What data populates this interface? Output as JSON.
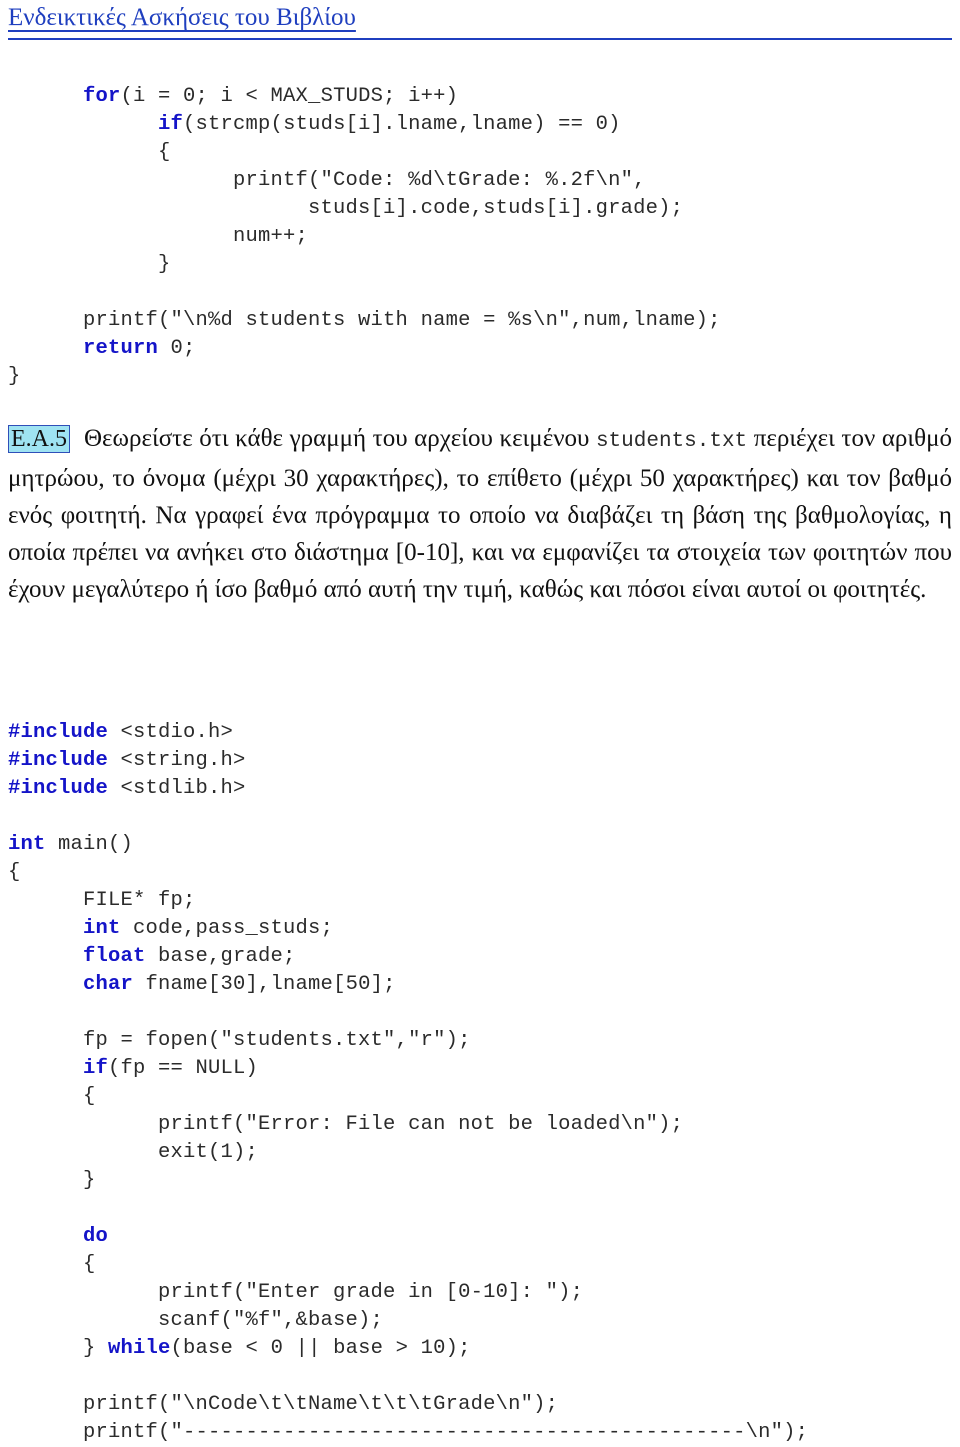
{
  "header": {
    "title": "Ενδεικτικές Ασκήσεις του Βιβλίου",
    "accent_color": "#1f3fbf"
  },
  "code_block_top": {
    "language": "c",
    "keyword_color": "#1414c8",
    "text_color": "#2b2b2b",
    "lines": [
      [
        {
          "t": "      ",
          "k": false
        },
        {
          "t": "for",
          "k": true
        },
        {
          "t": "(i = 0; i < MAX_STUDS; i++)",
          "k": false
        }
      ],
      [
        {
          "t": "            ",
          "k": false
        },
        {
          "t": "if",
          "k": true
        },
        {
          "t": "(strcmp(studs[i].lname,lname) == 0)",
          "k": false
        }
      ],
      [
        {
          "t": "            {",
          "k": false
        }
      ],
      [
        {
          "t": "                  printf(\"Code: %d\\tGrade: %.2f\\n\",",
          "k": false
        }
      ],
      [
        {
          "t": "                        studs[i].code,studs[i].grade);",
          "k": false
        }
      ],
      [
        {
          "t": "                  num++;",
          "k": false
        }
      ],
      [
        {
          "t": "            }",
          "k": false
        }
      ],
      [
        {
          "t": "",
          "k": false
        }
      ],
      [
        {
          "t": "      printf(\"\\n%d students with name = %s\\n\",num,lname);",
          "k": false
        }
      ],
      [
        {
          "t": "      ",
          "k": false
        },
        {
          "t": "return",
          "k": true
        },
        {
          "t": " 0;",
          "k": false
        }
      ],
      [
        {
          "t": "}",
          "k": false
        }
      ]
    ]
  },
  "exercise": {
    "badge": "Ε.Α.5",
    "badge_bg": "#9fe3f2",
    "badge_border": "#2f4fb8",
    "parts": [
      {
        "type": "text",
        "value": "Θεωρείστε ότι κάθε γραμμή του αρχείου κειμένου "
      },
      {
        "type": "mono",
        "value": "students.txt"
      },
      {
        "type": "text",
        "value": " περιέχει τον αριθμό μητρώου, το όνομα (μέχρι 30 χαρακτήρες), το επίθετο (μέχρι 50 χαρακτήρες) και τον βαθμό ενός φοιτητή. Να γραφεί ένα πρόγραμμα το οποίο να διαβάζει τη βάση της βαθμολογίας, η οποία πρέπει να ανήκει στο διάστημα [0-10], και να εμφανίζει τα στοιχεία των φοιτητών που έχουν μεγαλύτερο ή ίσο βαθμό από αυτή την τιμή, καθώς και πόσοι είναι αυτοί οι φοιτητές."
      }
    ]
  },
  "code_block_main": {
    "language": "c",
    "keyword_color": "#1414c8",
    "text_color": "#2b2b2b",
    "lines": [
      [
        {
          "t": "#include",
          "k": true
        },
        {
          "t": " <stdio.h>",
          "k": false
        }
      ],
      [
        {
          "t": "#include",
          "k": true
        },
        {
          "t": " <string.h>",
          "k": false
        }
      ],
      [
        {
          "t": "#include",
          "k": true
        },
        {
          "t": " <stdlib.h>",
          "k": false
        }
      ],
      [
        {
          "t": "",
          "k": false
        }
      ],
      [
        {
          "t": "int",
          "k": true
        },
        {
          "t": " main()",
          "k": false
        }
      ],
      [
        {
          "t": "{",
          "k": false
        }
      ],
      [
        {
          "t": "      FILE* fp;",
          "k": false
        }
      ],
      [
        {
          "t": "      ",
          "k": false
        },
        {
          "t": "int",
          "k": true
        },
        {
          "t": " code,pass_studs;",
          "k": false
        }
      ],
      [
        {
          "t": "      ",
          "k": false
        },
        {
          "t": "float",
          "k": true
        },
        {
          "t": " base,grade;",
          "k": false
        }
      ],
      [
        {
          "t": "      ",
          "k": false
        },
        {
          "t": "char",
          "k": true
        },
        {
          "t": " fname[30],lname[50];",
          "k": false
        }
      ],
      [
        {
          "t": "",
          "k": false
        }
      ],
      [
        {
          "t": "      fp = fopen(\"students.txt\",\"r\");",
          "k": false
        }
      ],
      [
        {
          "t": "      ",
          "k": false
        },
        {
          "t": "if",
          "k": true
        },
        {
          "t": "(fp == NULL)",
          "k": false
        }
      ],
      [
        {
          "t": "      {",
          "k": false
        }
      ],
      [
        {
          "t": "            printf(\"Error: File can not be loaded\\n\");",
          "k": false
        }
      ],
      [
        {
          "t": "            exit(1);",
          "k": false
        }
      ],
      [
        {
          "t": "      }",
          "k": false
        }
      ],
      [
        {
          "t": "",
          "k": false
        }
      ],
      [
        {
          "t": "      ",
          "k": false
        },
        {
          "t": "do",
          "k": true
        }
      ],
      [
        {
          "t": "      {",
          "k": false
        }
      ],
      [
        {
          "t": "            printf(\"Enter grade in [0-10]: \");",
          "k": false
        }
      ],
      [
        {
          "t": "            scanf(\"%f\",&base);",
          "k": false
        }
      ],
      [
        {
          "t": "      } ",
          "k": false
        },
        {
          "t": "while",
          "k": true
        },
        {
          "t": "(base < 0 || base > 10);",
          "k": false
        }
      ],
      [
        {
          "t": "",
          "k": false
        }
      ],
      [
        {
          "t": "      printf(\"\\nCode\\t\\tName\\t\\t\\tGrade\\n\");",
          "k": false
        }
      ],
      [
        {
          "t": "      printf(\"---------------------------------------------\\n\");",
          "k": false
        }
      ]
    ]
  }
}
